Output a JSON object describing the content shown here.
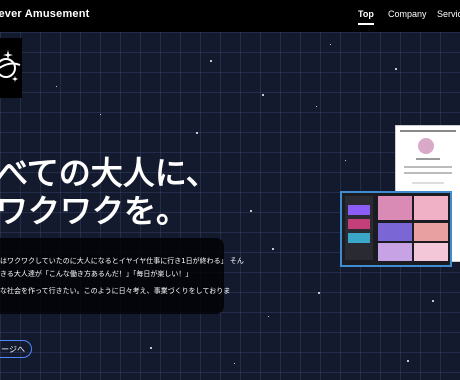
{
  "header": {
    "brand": "rever Amusement",
    "nav": [
      "Top",
      "Company",
      "Service"
    ]
  },
  "hero": {
    "line1": "べての大人に、",
    "line2": "ワクワクを。"
  },
  "description": {
    "line1": "はワクワクしていたのに大人になるとイヤイヤ仕事に行き1日が終わる」 そん",
    "line2": "きる大人達が「こんな働き方あるんだ！」「毎日が楽しい！」",
    "line3": "な社会を作って行きたい。このように日々考え、事業づくりをしておりま"
  },
  "button": {
    "label": "ージへ"
  },
  "colors": {
    "background": "#141a2e",
    "accent": "#4f87ff",
    "header": "#000000"
  }
}
